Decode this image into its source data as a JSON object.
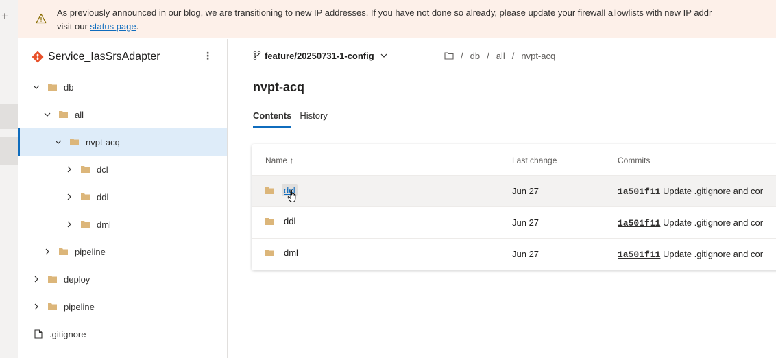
{
  "banner": {
    "text": "As previously announced in our blog, we are transitioning to new IP addresses. If you have not done so already, please update your firewall allowlists with new IP addr",
    "text_line2": "visit our ",
    "link": "status page",
    "tail": "."
  },
  "rail": {
    "plus": "+"
  },
  "repo": {
    "name": "Service_IasSrsAdapter",
    "more": "⋮"
  },
  "tree": [
    {
      "label": "db",
      "kind": "folder",
      "expanded": true
    },
    {
      "label": "all",
      "kind": "folder",
      "expanded": true
    },
    {
      "label": "nvpt-acq",
      "kind": "folder",
      "expanded": true,
      "selected": true
    },
    {
      "label": "dcl",
      "kind": "folder",
      "expanded": false
    },
    {
      "label": "ddl",
      "kind": "folder",
      "expanded": false
    },
    {
      "label": "dml",
      "kind": "folder",
      "expanded": false
    },
    {
      "label": "pipeline",
      "kind": "folder",
      "expanded": false
    },
    {
      "label": "deploy",
      "kind": "folder",
      "expanded": false
    },
    {
      "label": "pipeline",
      "kind": "folder",
      "expanded": false
    },
    {
      "label": ".gitignore",
      "kind": "file"
    }
  ],
  "branch": {
    "name": "feature/20250731-1-config"
  },
  "breadcrumb": {
    "items": [
      "db",
      "all",
      "nvpt-acq"
    ],
    "separator": "/"
  },
  "page": {
    "title": "nvpt-acq"
  },
  "tabs": {
    "contents": "Contents",
    "history": "History"
  },
  "table": {
    "columns": {
      "name": "Name ↑",
      "last_change": "Last change",
      "commits": "Commits"
    },
    "rows": [
      {
        "name": "dcl",
        "last_change": "Jun 27",
        "hash": "1a501f11",
        "message": "Update .gitignore and cor"
      },
      {
        "name": "ddl",
        "last_change": "Jun 27",
        "hash": "1a501f11",
        "message": "Update .gitignore and cor"
      },
      {
        "name": "dml",
        "last_change": "Jun 27",
        "hash": "1a501f11",
        "message": "Update .gitignore and cor"
      }
    ]
  },
  "colors": {
    "accent": "#0f6cbd",
    "banner_bg": "#fdf0e9",
    "folder": "#dcb67a",
    "selected_bg": "#deecf9"
  }
}
